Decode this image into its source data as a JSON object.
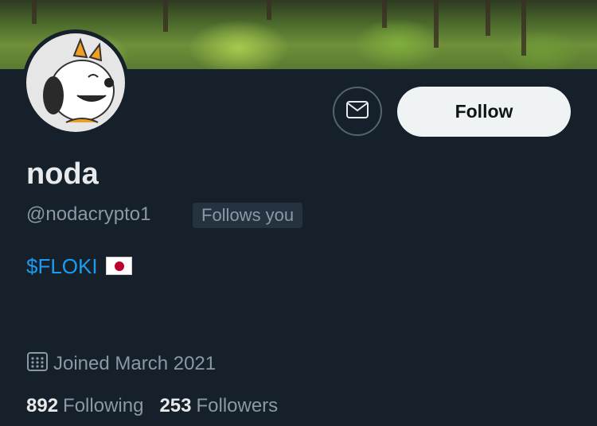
{
  "profile": {
    "name": "noda",
    "handle": "@nodacrypto1",
    "follows_you": "Follows you",
    "bio_text": "$FLOKI",
    "joined": "Joined March 2021",
    "following_count": "892",
    "following_label": "Following",
    "followers_count": "253",
    "followers_label": "Followers"
  },
  "actions": {
    "follow_label": "Follow",
    "message_icon": "envelope-icon"
  },
  "icons": {
    "calendar": "calendar-icon",
    "flag": "japan-flag-emoji"
  },
  "colors": {
    "background": "#15202b",
    "link": "#1d9bf0",
    "secondary_text": "#8b98a5"
  }
}
